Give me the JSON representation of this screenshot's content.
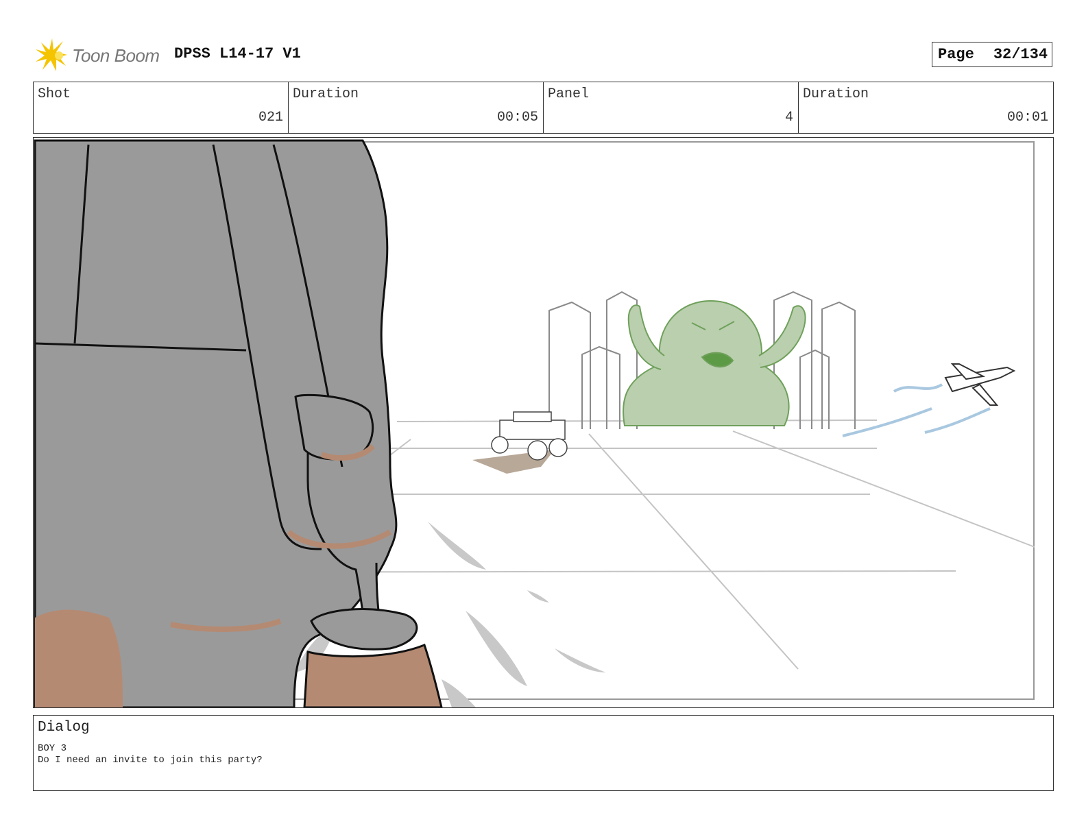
{
  "header": {
    "logo_text": "Toon Boom",
    "project_title": "DPSS L14-17 V1",
    "page_label": "Page",
    "page_number": "32/134"
  },
  "info": {
    "shot_label": "Shot",
    "shot_value": "021",
    "shot_duration_label": "Duration",
    "shot_duration_value": "00:05",
    "panel_label": "Panel",
    "panel_value": "4",
    "panel_duration_label": "Duration",
    "panel_duration_value": "00:01"
  },
  "dialog": {
    "label": "Dialog",
    "speaker": "BOY 3",
    "line": "Do I need an invite to join this party?"
  },
  "colors": {
    "logo_yellow": "#f5c400",
    "character_gray": "#9a9a9a",
    "skin_tone": "#b58a72",
    "monster_green": "#b9cfae",
    "splash_gray": "#c8c8c8",
    "jet_trail_blue": "#a9c8e0"
  }
}
